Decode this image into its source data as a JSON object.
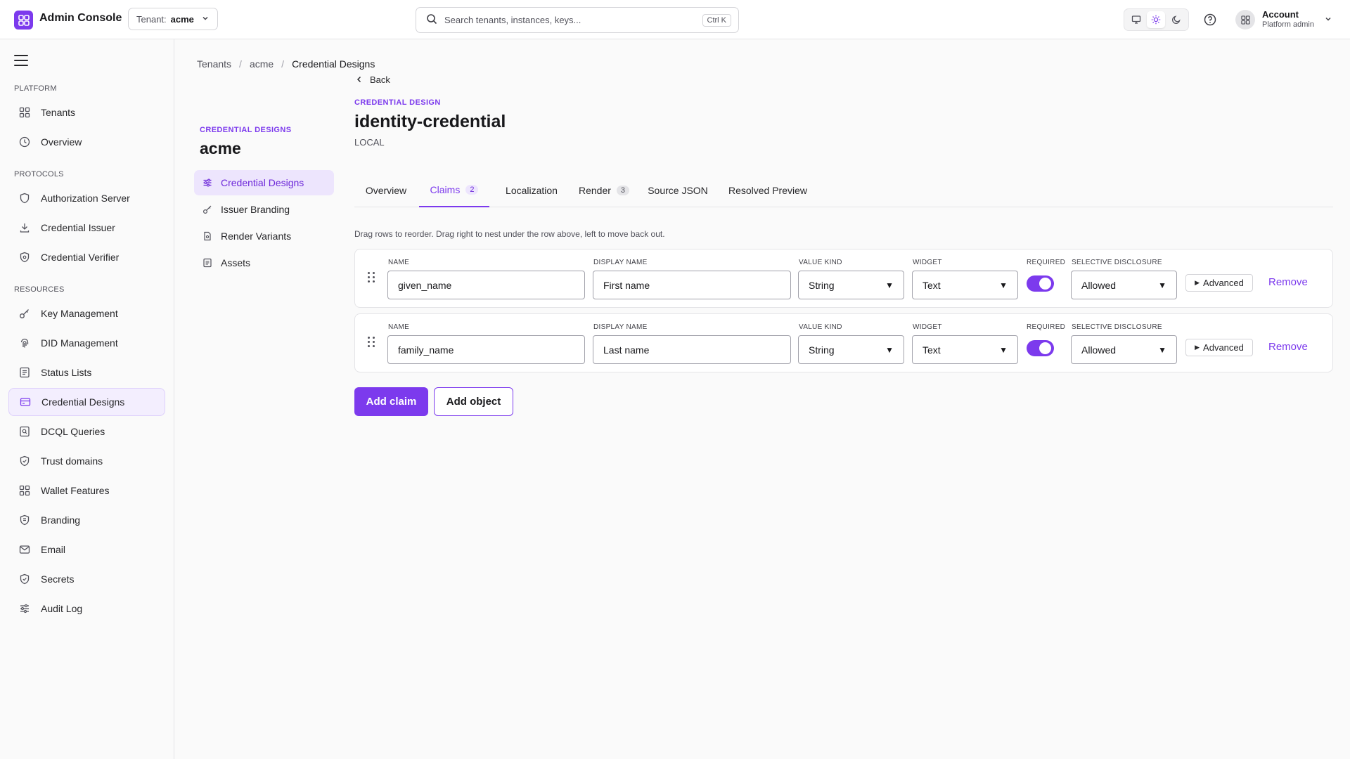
{
  "header": {
    "app_title": "Admin Console",
    "tenant_label": "Tenant:",
    "tenant_value": "acme",
    "search_placeholder": "Search tenants, instances, keys...",
    "search_shortcut": "Ctrl K",
    "account_name": "Account",
    "account_role": "Platform admin"
  },
  "sidebar": {
    "sections": [
      {
        "title": "PLATFORM",
        "items": [
          {
            "label": "Tenants",
            "icon": "grid-icon"
          },
          {
            "label": "Overview",
            "icon": "clock-icon"
          }
        ]
      },
      {
        "title": "PROTOCOLS",
        "items": [
          {
            "label": "Authorization Server",
            "icon": "shield-icon"
          },
          {
            "label": "Credential Issuer",
            "icon": "download-icon"
          },
          {
            "label": "Credential Verifier",
            "icon": "shield-check-icon"
          }
        ]
      },
      {
        "title": "RESOURCES",
        "items": [
          {
            "label": "Key Management",
            "icon": "key-icon"
          },
          {
            "label": "DID Management",
            "icon": "fingerprint-icon"
          },
          {
            "label": "Status Lists",
            "icon": "list-icon"
          },
          {
            "label": "Credential Designs",
            "icon": "card-icon",
            "active": true
          },
          {
            "label": "DCQL Queries",
            "icon": "query-icon"
          },
          {
            "label": "Trust domains",
            "icon": "shield-icon"
          },
          {
            "label": "Wallet Features",
            "icon": "grid-icon"
          },
          {
            "label": "Branding",
            "icon": "badge-icon"
          },
          {
            "label": "Email",
            "icon": "mail-icon"
          },
          {
            "label": "Secrets",
            "icon": "shield-icon"
          },
          {
            "label": "Audit Log",
            "icon": "sliders-icon"
          }
        ]
      }
    ]
  },
  "breadcrumbs": [
    "Tenants",
    "acme",
    "Credential Designs"
  ],
  "subnav": {
    "eyebrow": "CREDENTIAL DESIGNS",
    "title": "acme",
    "items": [
      {
        "label": "Credential Designs",
        "icon": "sliders-icon",
        "active": true
      },
      {
        "label": "Issuer Branding",
        "icon": "key-icon"
      },
      {
        "label": "Render Variants",
        "icon": "file-icon"
      },
      {
        "label": "Assets",
        "icon": "list-icon"
      }
    ]
  },
  "back_label": "Back",
  "design": {
    "eyebrow": "CREDENTIAL DESIGN",
    "title": "identity-credential",
    "scope": "LOCAL"
  },
  "tabs": [
    {
      "label": "Overview"
    },
    {
      "label": "Claims",
      "badge": "2",
      "active": true
    },
    {
      "label": "Localization"
    },
    {
      "label": "Render",
      "badge": "3"
    },
    {
      "label": "Source JSON"
    },
    {
      "label": "Resolved Preview"
    }
  ],
  "claims": {
    "hint": "Drag rows to reorder. Drag right to nest under the row above, left to move back out.",
    "field_labels": {
      "name": "NAME",
      "display_name": "DISPLAY NAME",
      "value_kind": "VALUE KIND",
      "widget": "WIDGET",
      "required": "REQUIRED",
      "selective_disclosure": "SELECTIVE DISCLOSURE"
    },
    "advanced_label": "Advanced",
    "remove_label": "Remove",
    "rows": [
      {
        "name": "given_name",
        "display_name": "First name",
        "value_kind": "String",
        "widget": "Text",
        "required": true,
        "selective_disclosure": "Allowed"
      },
      {
        "name": "family_name",
        "display_name": "Last name",
        "value_kind": "String",
        "widget": "Text",
        "required": true,
        "selective_disclosure": "Allowed"
      }
    ],
    "add_claim_label": "Add claim",
    "add_object_label": "Add object"
  },
  "colors": {
    "accent": "#7c3aed",
    "accent_soft": "#ede5fd"
  }
}
